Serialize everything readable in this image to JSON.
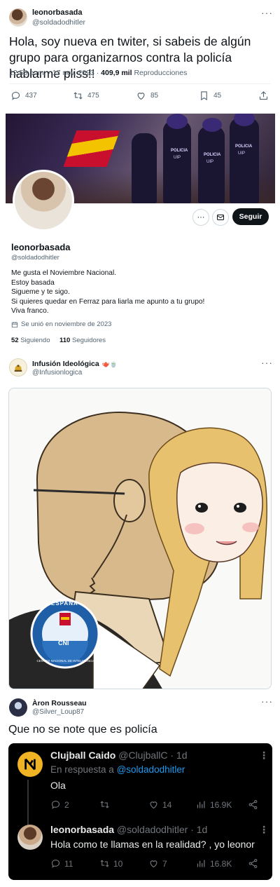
{
  "tweet": {
    "display_name": "leonorbasada",
    "handle": "@soldadodhitler",
    "text": "Hola, soy nueva en twiter, si sabeis de algún grupo para organizarnos contra la policía hablarme pliss!!",
    "time": "12:55 p. m. · 17 nov. 2023 ·",
    "views_count": "409,9 mil",
    "views_label": "Reproducciones",
    "replies": "437",
    "retweets": "475",
    "likes": "85",
    "bookmarks": "45",
    "more": "···"
  },
  "profile": {
    "display_name": "leonorbasada",
    "handle": "@soldadodhitler",
    "follow_label": "Seguir",
    "bio_lines": [
      "Me gusta el Noviembre Nacional.",
      "Estoy basada",
      "Sigueme y te sigo.",
      "Si quieres quedar en Ferraz para liarla me apunto a tu grupo!",
      "Viva franco."
    ],
    "joined": "Se unió en noviembre de 2023",
    "following_count": "52",
    "following_label": "Siguiendo",
    "followers_count": "110",
    "followers_label": "Seguidores",
    "banner_badges": [
      "POLICIA",
      "UIP",
      "POLICIA",
      "UIP",
      "POLICIA",
      "UIP"
    ]
  },
  "post": {
    "display_name": "Infusión Ideológica",
    "handle": "@Infusionlogica",
    "emoji": "🫖🍵",
    "more": "···",
    "badge_top": "ESPAÑA",
    "badge_mid": "CNI",
    "badge_ring": "CENTRO NACIONAL DE INTELIGENCIA"
  },
  "reply_post": {
    "display_name": "Àron Rousseau",
    "handle": "@Silver_Loup87",
    "text": "Que no se note que es policía",
    "more": "···"
  },
  "thread": [
    {
      "display_name": "Clujball Caido",
      "handle": "@ClujballC",
      "age": "· 1d",
      "reply_prefix": "En respuesta a",
      "reply_to": "@soldadodhitler",
      "text": "Ola",
      "replies": "2",
      "retweets": "",
      "likes": "14",
      "views": "16.9K"
    },
    {
      "display_name": "leonorbasada",
      "handle": "@soldadodhitler",
      "age": "· 1d",
      "text": "Hola como te llamas en la realidad? , yo leonor",
      "replies": "11",
      "retweets": "10",
      "likes": "7",
      "views": "16.8K"
    }
  ],
  "colors": {
    "accent": "#1d9bf0",
    "text": "#0f1419",
    "muted": "#536471",
    "dark_bg": "#000000"
  }
}
